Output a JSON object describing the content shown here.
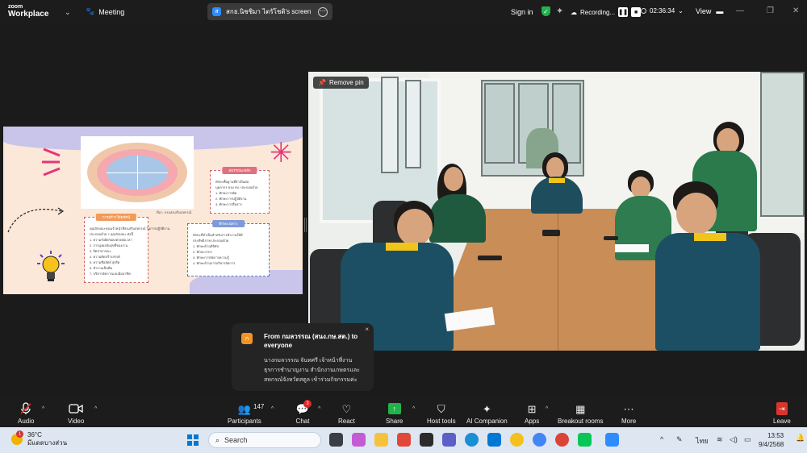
{
  "topbar": {
    "logo_line1": "zoom",
    "logo_line2": "Workplace",
    "meeting_label": "Meeting",
    "share_badge": "ส",
    "share_label": "สกธ.นิชชิมา ไตรัโชติ's screen",
    "share_more": "⋯",
    "sign_in": "Sign in",
    "recording_label": "Recording...",
    "pause_glyph": "❚❚",
    "stop_glyph": "■",
    "timer": "02:36:34",
    "view_label": "View"
  },
  "slide": {
    "box_left_title": "การสร้างวิสัยทัศน์",
    "box_left_lines": [
      "คุณลักษณะของเจ้าหน้าที่ส่งเสริมสหกรณ์ ในการปฏิบัติงาน",
      "ประกอบด้วย 7 คุณลักษณะ ดังนี้",
      "1. ความรับผิดชอบ/ตรงต่อเวลา",
      "2. การมุ่งผลสัมฤทธิ์ของงาน",
      "3. จิตสาธารณะ",
      "4. ความคิดสร้างสรรค์",
      "5. ความซื่อสัตย์ สุจริต",
      "6. ทำงานเป็นทีม",
      "7. บริหารจัดการแบบมืออาชีพ"
    ],
    "box_right_top_title": "สมรรถนะหลัก",
    "box_right_top_lines": [
      "ทักษะพื้นฐานที่จำเป็นต่อ",
      "บุคลากร ของ กษ. ประกอบด้วย",
      "1. ทักษะการคิด",
      "2. ทักษะการปฏิบัติงาน",
      "3. ทักษะการสื่อสาร"
    ],
    "box_right_mid_title": "ทักษะเฉพาะ",
    "box_right_mid_lines": [
      "ทักษะที่จำเป็นสำหรับการทำงานให้มี",
      "ประสิทธิภาพ ประกอบด้วย",
      "1. ทักษะด้านดิจิทัล",
      "2. ทักษะภาษา",
      "3. ทักษะการจัดการความรู้",
      "4. ทักษะด้านการบริหารจัดการ"
    ],
    "caption": "ที่มา: กรมส่งเสริมสหกรณ์"
  },
  "video": {
    "remove_pin": "Remove pin"
  },
  "toast": {
    "avatar": "ก",
    "close": "×",
    "from": "From กมลวรรณ (สนง.กษ.สต.) to everyone",
    "message": "นางกมลวรรณ จันทศรี เจ้าหน้าที่งานธุรการชำนาญงาน สำนักงานเกษตรและสหกรณ์จังหวัดสตูล เข้าร่วมกิจกรรมค่ะ"
  },
  "toolbar": {
    "audio": "Audio",
    "video": "Video",
    "participants": "Participants",
    "participant_count": "147",
    "chat": "Chat",
    "chat_badge": "3",
    "react": "React",
    "share": "Share",
    "host_tools": "Host tools",
    "ai_companion": "AI Companion",
    "apps": "Apps",
    "breakout_rooms": "Breakout rooms",
    "more": "More",
    "leave": "Leave"
  },
  "taskbar": {
    "temperature": "36°C",
    "weather_desc": "มีแดดบางส่วน",
    "notification_count": "1",
    "search_placeholder": "Search",
    "language": "ไทย",
    "time": "13:53",
    "date": "9/4/2568"
  },
  "colors": {
    "zoom_blue": "#2d8cff",
    "share_green": "#22b24c",
    "leave_red": "#d8352c",
    "chat_badge_red": "#e02828",
    "toast_avatar_orange": "#f29425"
  }
}
